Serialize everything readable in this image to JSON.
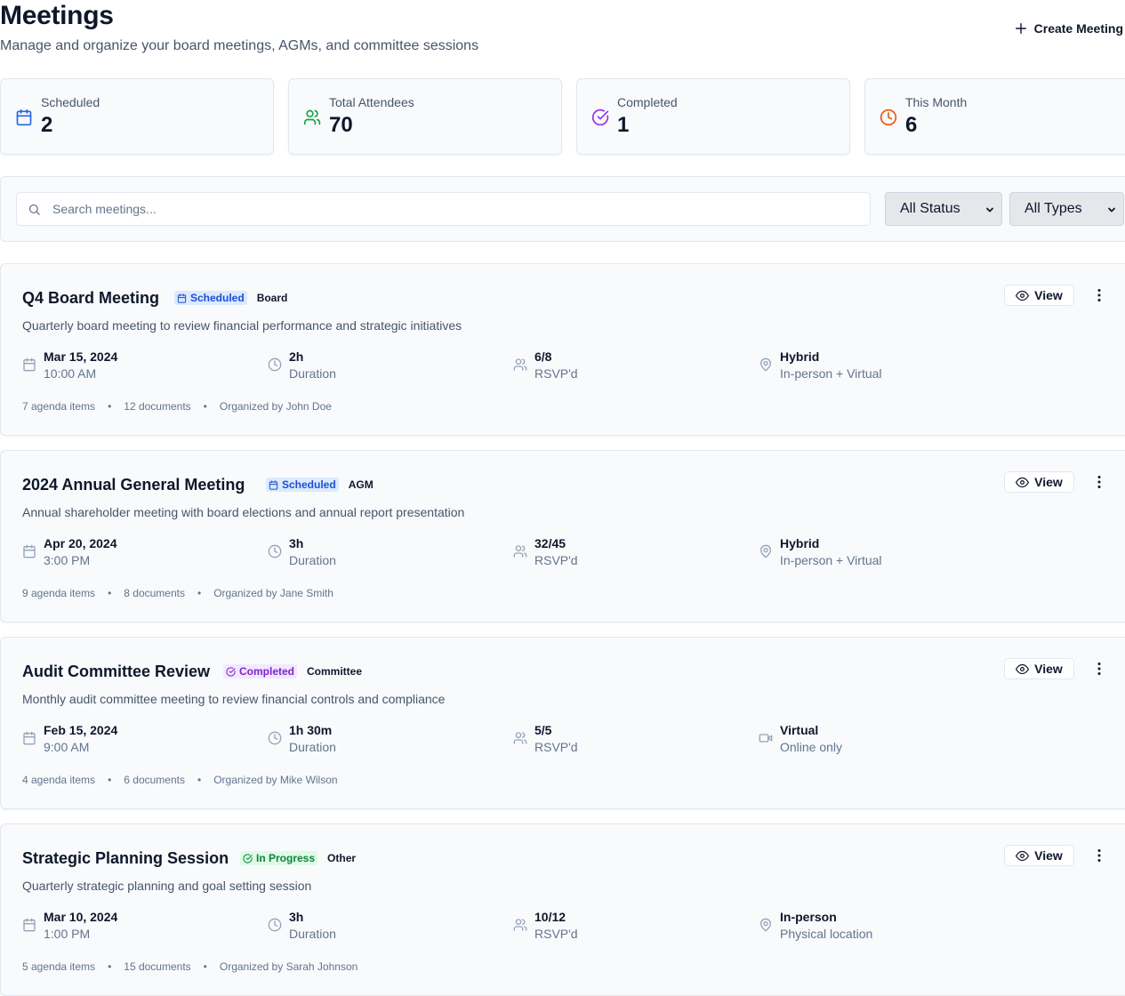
{
  "header": {
    "title": "Meetings",
    "subtitle": "Manage and organize your board meetings, AGMs, and committee sessions",
    "create_label": "Create Meeting"
  },
  "stats": [
    {
      "label": "Scheduled",
      "value": "2",
      "icon": "calendar-icon",
      "color": "#2563eb"
    },
    {
      "label": "Total Attendees",
      "value": "70",
      "icon": "users-icon",
      "color": "#16a34a"
    },
    {
      "label": "Completed",
      "value": "1",
      "icon": "check-circle-icon",
      "color": "#9333ea"
    },
    {
      "label": "This Month",
      "value": "6",
      "icon": "clock-icon",
      "color": "#ea580c"
    }
  ],
  "filters": {
    "search_placeholder": "Search meetings...",
    "status_selected": "All Status",
    "type_selected": "All Types"
  },
  "view_label": "View",
  "meetings": [
    {
      "title": "Q4 Board Meeting",
      "status": "Scheduled",
      "type": "Board",
      "description": "Quarterly board meeting to review financial performance and strategic initiatives",
      "date": "Mar 15, 2024",
      "time": "10:00 AM",
      "duration": "2h",
      "duration_label": "Duration",
      "rsvp": "6/8",
      "rsvp_label": "RSVP'd",
      "location": "Hybrid",
      "location_detail": "In-person + Virtual",
      "agenda": "7 agenda items",
      "documents": "12 documents",
      "organizer": "Organized by John Doe"
    },
    {
      "title": "2024 Annual General Meeting",
      "status": "Scheduled",
      "type": "AGM",
      "description": "Annual shareholder meeting with board elections and annual report presentation",
      "date": "Apr 20, 2024",
      "time": "3:00 PM",
      "duration": "3h",
      "duration_label": "Duration",
      "rsvp": "32/45",
      "rsvp_label": "RSVP'd",
      "location": "Hybrid",
      "location_detail": "In-person + Virtual",
      "agenda": "9 agenda items",
      "documents": "8 documents",
      "organizer": "Organized by Jane Smith"
    },
    {
      "title": "Audit Committee Review",
      "status": "Completed",
      "type": "Committee",
      "description": "Monthly audit committee meeting to review financial controls and compliance",
      "date": "Feb 15, 2024",
      "time": "9:00 AM",
      "duration": "1h 30m",
      "duration_label": "Duration",
      "rsvp": "5/5",
      "rsvp_label": "RSVP'd",
      "location": "Virtual",
      "location_detail": "Online only",
      "agenda": "4 agenda items",
      "documents": "6 documents",
      "organizer": "Organized by Mike Wilson"
    },
    {
      "title": "Strategic Planning Session",
      "status": "In Progress",
      "type": "Other",
      "description": "Quarterly strategic planning and goal setting session",
      "date": "Mar 10, 2024",
      "time": "1:00 PM",
      "duration": "3h",
      "duration_label": "Duration",
      "rsvp": "10/12",
      "rsvp_label": "RSVP'd",
      "location": "In-person",
      "location_detail": "Physical location",
      "agenda": "5 agenda items",
      "documents": "15 documents",
      "organizer": "Organized by Sarah Johnson"
    }
  ]
}
